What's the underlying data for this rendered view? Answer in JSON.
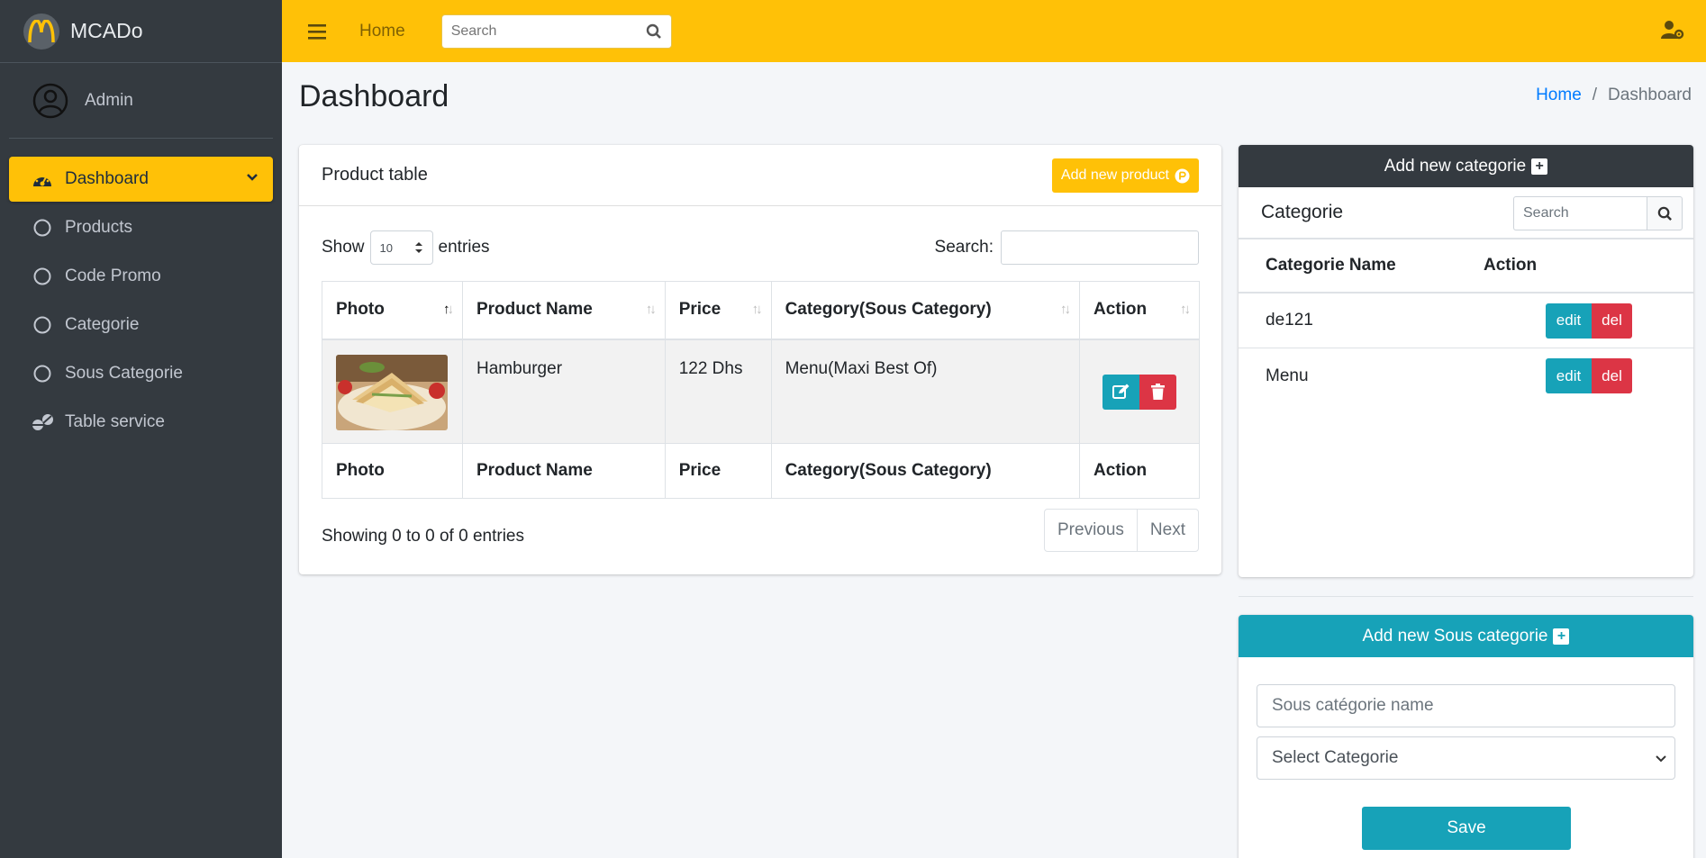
{
  "brand": {
    "name": "MCADo"
  },
  "user": {
    "name": "Admin"
  },
  "sidebar": {
    "items": [
      {
        "label": "Dashboard",
        "active": true
      },
      {
        "label": "Products"
      },
      {
        "label": "Code Promo"
      },
      {
        "label": "Categorie"
      },
      {
        "label": "Sous Categorie"
      },
      {
        "label": "Table service"
      }
    ]
  },
  "topbar": {
    "home_label": "Home",
    "search_placeholder": "Search"
  },
  "page": {
    "title": "Dashboard"
  },
  "breadcrumb": {
    "home": "Home",
    "sep": "/",
    "current": "Dashboard"
  },
  "product_card": {
    "title": "Product table",
    "add_button": "Add new product",
    "show_label": "Show",
    "entries_value": "10",
    "entries_label": "entries",
    "search_label": "Search:",
    "columns": [
      "Photo",
      "Product Name",
      "Price",
      "Category(Sous Category)",
      "Action"
    ],
    "rows": [
      {
        "name": "Hamburger",
        "price": "122 Dhs",
        "category": "Menu(Maxi Best Of)"
      }
    ],
    "showing": "Showing 0 to 0 of 0 entries",
    "prev": "Previous",
    "next": "Next"
  },
  "categorie_card": {
    "header": "Add new categorie",
    "title": "Categorie",
    "search_placeholder": "Search",
    "columns": [
      "Categorie Name",
      "Action"
    ],
    "rows": [
      {
        "name": "de121",
        "edit": "edit",
        "del": "del"
      },
      {
        "name": "Menu",
        "edit": "edit",
        "del": "del"
      }
    ]
  },
  "sous_card": {
    "header": "Add new Sous categorie",
    "name_placeholder": "Sous catégorie name",
    "select_value": "Select Categorie",
    "save": "Save"
  },
  "colors": {
    "accent": "#ffc107",
    "sidebar": "#343a40",
    "info": "#17a2b8",
    "danger": "#dc3545"
  }
}
